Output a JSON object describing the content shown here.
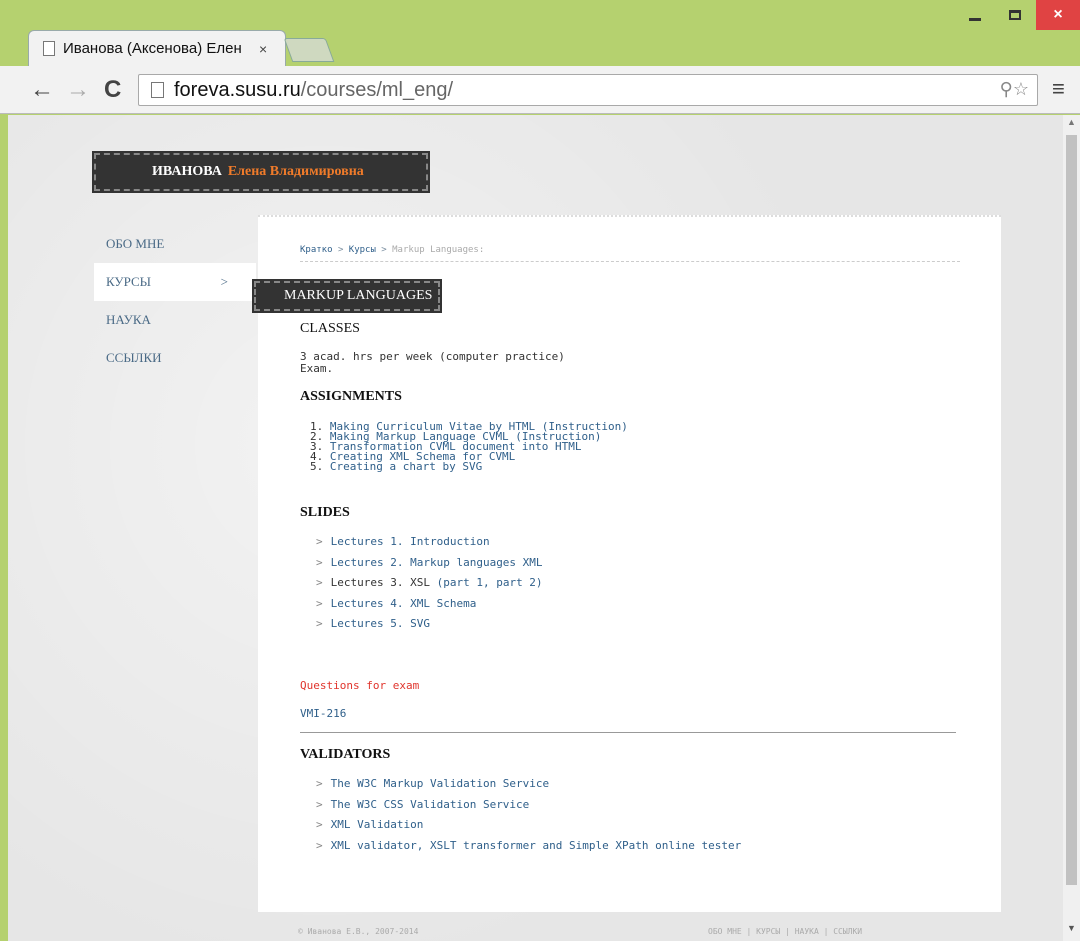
{
  "browser": {
    "tab_title": "Иванова (Аксенова) Елен",
    "tab_close": "×",
    "url_host": "foreva.susu.ru",
    "url_path": "/courses/ml_eng/",
    "back": "←",
    "forward": "→",
    "reload": "C",
    "menu": "≡",
    "omni_icons": "⚲☆",
    "win_close": "×"
  },
  "header": {
    "last_name": "ИВАНОВА",
    "first_names": "Елена Владимировна"
  },
  "sidenav": {
    "items": [
      {
        "label": "ОБО МНЕ"
      },
      {
        "label": "КУРСЫ",
        "arrow": ">"
      },
      {
        "label": "НАУКА"
      },
      {
        "label": "ССЫЛКИ"
      }
    ]
  },
  "breadcrumb": {
    "items": [
      "Кратко",
      "Курсы"
    ],
    "sep": ">",
    "current": "Markup Languages:"
  },
  "page": {
    "section_title": "MARKUP LANGUAGES",
    "classes_heading": "CLASSES",
    "classes_line1": "3 acad. hrs per week (computer practice)",
    "classes_line2": "Exam.",
    "assignments_heading": "ASSIGNMENTS",
    "assignments": [
      {
        "num": "1.",
        "text": "Making Curriculum Vitae by HTML (Instruction)"
      },
      {
        "num": "2.",
        "text": "Making Markup Language CVML (Instruction)"
      },
      {
        "num": "3.",
        "text": "Transformation CVML document into HTML"
      },
      {
        "num": "4.",
        "text": "Creating XML Schema for CVML"
      },
      {
        "num": "5.",
        "text": "Creating a chart by SVG"
      }
    ],
    "slides_heading": "SLIDES",
    "slides": [
      {
        "text": "Lectures 1. Introduction"
      },
      {
        "text": "Lectures 2. Markup languages XML"
      },
      {
        "text": "Lectures 3. XSL",
        "extra": "(part 1, part 2)"
      },
      {
        "text": "Lectures 4. XML Schema"
      },
      {
        "text": "Lectures 5. SVG"
      }
    ],
    "questions": "Questions for exam",
    "group": "VMI-216",
    "validators_heading": "VALIDATORS",
    "validators": [
      {
        "text": "The W3C Markup Validation Service"
      },
      {
        "text": "The W3C CSS Validation Service"
      },
      {
        "text": "XML Validation"
      },
      {
        "text": "XML validator, XSLT transformer and Simple XPath online tester"
      }
    ],
    "list_arrow": ">"
  },
  "footer": {
    "copyright": "© Иванова Е.В., 2007-2014",
    "links": "ОБО МНЕ | КУРСЫ | НАУКА | ССЫЛКИ"
  }
}
